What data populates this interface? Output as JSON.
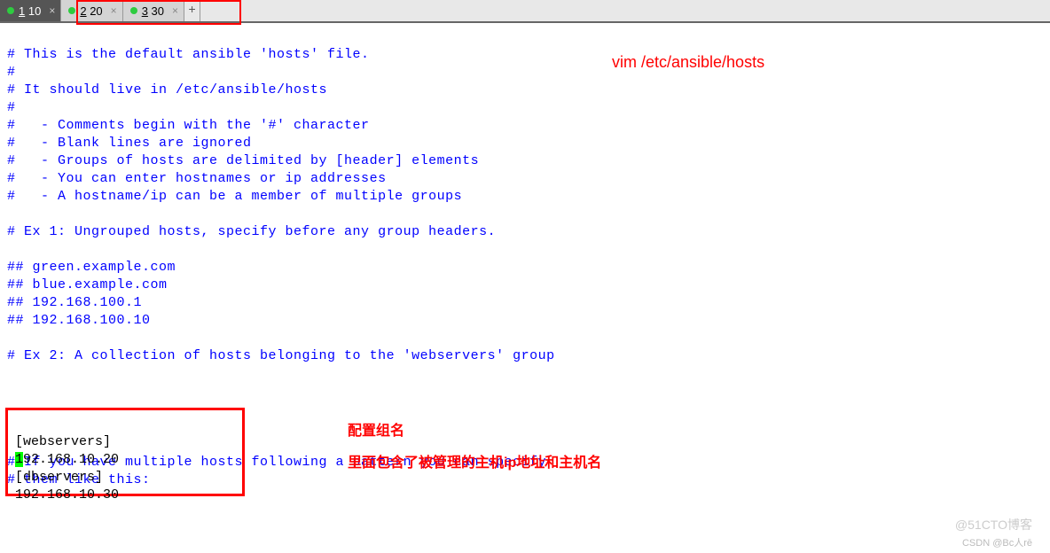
{
  "tabs": [
    {
      "num": "1",
      "label": "10",
      "active": true
    },
    {
      "num": "2",
      "label": "20",
      "active": false
    },
    {
      "num": "3",
      "label": "30",
      "active": false
    }
  ],
  "file": {
    "l1": "# This is the default ansible 'hosts' file.",
    "l2": "#",
    "l3": "# It should live in /etc/ansible/hosts",
    "l4": "#",
    "l5": "#   - Comments begin with the '#' character",
    "l6": "#   - Blank lines are ignored",
    "l7": "#   - Groups of hosts are delimited by [header] elements",
    "l8": "#   - You can enter hostnames or ip addresses",
    "l9": "#   - A hostname/ip can be a member of multiple groups",
    "l10": "# Ex 1: Ungrouped hosts, specify before any group headers.",
    "l11": "## green.example.com",
    "l12": "## blue.example.com",
    "l13": "## 192.168.100.1",
    "l14": "## 192.168.100.10",
    "l15": "# Ex 2: A collection of hosts belonging to the 'webservers' group",
    "l16": "# If you have multiple hosts following a pattern you can specify",
    "l17": "# them like this:"
  },
  "config": {
    "l1": "[webservers]",
    "l2_first": "1",
    "l2_rest": "92.168.10.20",
    "l3": "[dbservers]",
    "l4": "192.168.10.30"
  },
  "annotations": {
    "cmd": "vim /etc/ansible/hosts",
    "note1": "配置组名",
    "note2": "里面包含了被管理的主机ip地址和主机名"
  },
  "watermark": {
    "w1": "@51CTO博客",
    "w2": "CSDN @Bc人rē"
  }
}
